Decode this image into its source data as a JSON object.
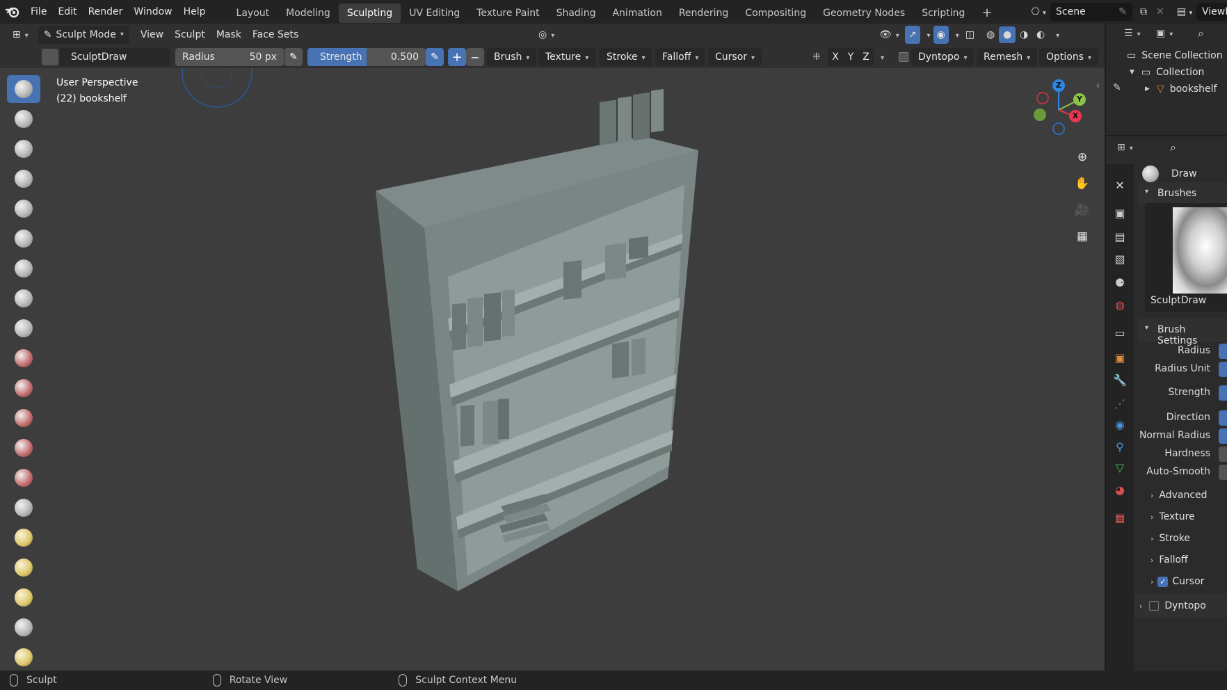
{
  "topbar": {
    "menus": [
      "File",
      "Edit",
      "Render",
      "Window",
      "Help"
    ],
    "workspaces": [
      "Layout",
      "Modeling",
      "Sculpting",
      "UV Editing",
      "Texture Paint",
      "Shading",
      "Animation",
      "Rendering",
      "Compositing",
      "Geometry Nodes",
      "Scripting"
    ],
    "active_workspace": "Sculpting",
    "add_tab": "+",
    "scene_name": "Scene",
    "view_layer": "ViewLa"
  },
  "header": {
    "mode": "Sculpt Mode",
    "menus": [
      "View",
      "Sculpt",
      "Mask",
      "Face Sets"
    ]
  },
  "tool_settings": {
    "brush_name": "SculptDraw",
    "radius_label": "Radius",
    "radius_value": "50 px",
    "strength_label": "Strength",
    "strength_value": "0.500",
    "plus": "+",
    "minus": "−",
    "dropdowns": [
      "Brush",
      "Texture",
      "Stroke",
      "Falloff",
      "Cursor"
    ],
    "axes": [
      "X",
      "Y",
      "Z"
    ],
    "dyntopo": "Dyntopo",
    "remesh": "Remesh",
    "options": "Options"
  },
  "viewport": {
    "view_name": "User Perspective",
    "object_info": "(22) bookshelf",
    "gizmo": {
      "z": "Z",
      "y": "Y",
      "x": "X"
    }
  },
  "outliner": {
    "scene_collection": "Scene Collection",
    "collection": "Collection",
    "object": "bookshelf"
  },
  "properties": {
    "brush_name": "Draw",
    "brushes_panel": "Brushes",
    "brush_preview_name": "SculptDraw",
    "brush_settings_panel": "Brush Settings",
    "settings": [
      "Radius",
      "Radius Unit",
      "Strength",
      "Direction",
      "Normal Radius",
      "Hardness",
      "Auto-Smooth"
    ],
    "subpanels": [
      "Advanced",
      "Texture",
      "Stroke",
      "Falloff"
    ],
    "cursor_panel": "Cursor",
    "dyntopo_panel": "Dyntopo"
  },
  "statusbar": {
    "left": "Sculpt",
    "middle": "Rotate View",
    "right": "Sculpt Context Menu"
  },
  "colors": {
    "accent": "#4772b3",
    "viewport_bg": "#3d3d3d",
    "axis_x": "#e8384f",
    "axis_y": "#8bc34a",
    "axis_z": "#2f85e6"
  }
}
